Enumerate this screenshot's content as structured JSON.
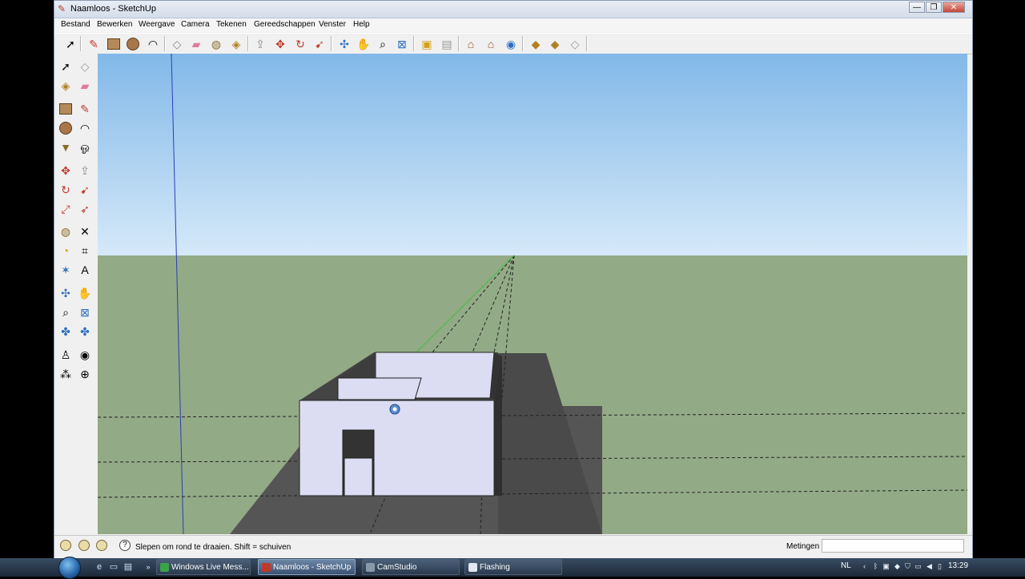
{
  "window": {
    "title": "Naamloos - SketchUp",
    "controls": [
      "—",
      "❐",
      "✕"
    ]
  },
  "menu": [
    "Bestand",
    "Bewerken",
    "Weergave",
    "Camera",
    "Tekenen",
    "Gereedschappen",
    "Venster",
    "Help"
  ],
  "toolbar": {
    "icons": [
      "select-icon",
      "line-icon",
      "rectangle-icon",
      "circle-icon",
      "arc-icon",
      "make-component-icon",
      "eraser-icon",
      "tape-measure-icon",
      "paint-bucket-icon",
      "push-pull-icon",
      "move-icon",
      "rotate-icon",
      "follow-me-icon",
      "orbit-icon",
      "pan-icon",
      "zoom-icon",
      "zoom-extents-icon",
      "add-location-icon",
      "toggle-terrain-icon",
      "get-models-icon",
      "share-model-icon",
      "google-earth-icon",
      "get-components-icon",
      "share-component-icon",
      "send-to-layout-icon"
    ]
  },
  "left_toolbar": {
    "icons": [
      [
        "select-icon",
        "make-component-icon"
      ],
      [
        "paint-bucket-icon",
        "eraser-icon"
      ],
      [
        "rectangle-icon",
        "line-icon"
      ],
      [
        "circle-icon",
        "arc-icon"
      ],
      [
        "polygon-icon",
        "freehand-icon"
      ],
      [
        "move-icon",
        "push-pull-icon"
      ],
      [
        "rotate-icon",
        "follow-me-icon"
      ],
      [
        "scale-icon",
        "offset-icon"
      ],
      [
        "tape-measure-icon",
        "dimension-icon"
      ],
      [
        "protractor-icon",
        "text-icon"
      ],
      [
        "axes-icon",
        "3d-text-icon"
      ],
      [
        "orbit-icon",
        "pan-icon"
      ],
      [
        "zoom-icon",
        "zoom-window-icon"
      ],
      [
        "previous-view-icon",
        "next-view-icon"
      ],
      [
        "position-camera-icon",
        "look-around-icon"
      ],
      [
        "walk-icon",
        "section-plane-icon"
      ]
    ]
  },
  "statusbar": {
    "hint": "Slepen om rond te draaien. Shift = schuiven",
    "measurements_label": "Metingen",
    "measurements_value": ""
  },
  "taskbar": {
    "tasks": [
      {
        "label": "Windows Live Mess...",
        "active": false,
        "color": "#3aa34a"
      },
      {
        "label": "Naamloos - SketchUp",
        "active": true,
        "color": "#c0392b"
      },
      {
        "label": "CamStudio",
        "active": false,
        "color": "#8899aa"
      },
      {
        "label": "Flashing",
        "active": false,
        "color": "#dfe7f1"
      }
    ],
    "language": "NL",
    "clock": "13:29"
  },
  "colors": {
    "sky_top": "#82b8e8",
    "sky_bottom": "#d5e9f9",
    "ground": "#93aa86",
    "wall": "#dcdcf3",
    "shadow": "#555555"
  }
}
